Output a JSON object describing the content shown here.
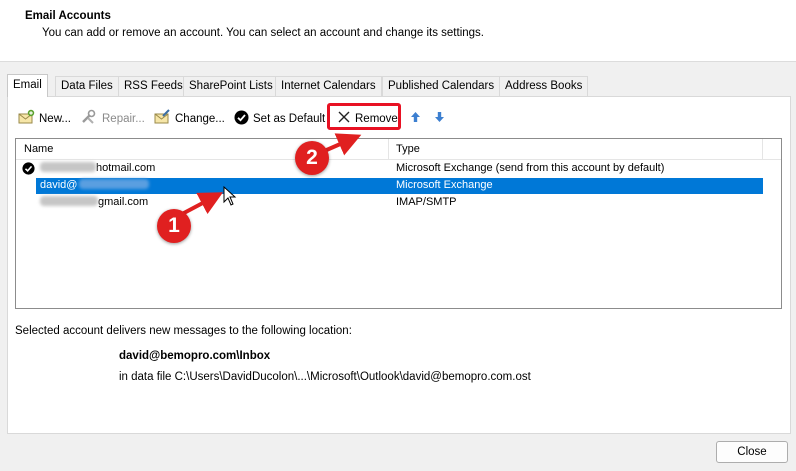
{
  "header": {
    "title": "Email Accounts",
    "subtitle": "You can add or remove an account. You can select an account and change its settings."
  },
  "tabs": [
    {
      "label": "Email",
      "active": true
    },
    {
      "label": "Data Files"
    },
    {
      "label": "RSS Feeds"
    },
    {
      "label": "SharePoint Lists"
    },
    {
      "label": "Internet Calendars"
    },
    {
      "label": "Published Calendars"
    },
    {
      "label": "Address Books"
    }
  ],
  "toolbar": {
    "new_label": "New...",
    "repair_label": "Repair...",
    "change_label": "Change...",
    "set_default_label": "Set as Default",
    "remove_label": "Remove"
  },
  "list": {
    "col_name": "Name",
    "col_type": "Type",
    "rows": [
      {
        "name": "hotmail.com",
        "type": "Microsoft Exchange (send from this account by default)",
        "default": true
      },
      {
        "name": "david@",
        "type": "Microsoft Exchange",
        "selected": true
      },
      {
        "name": "gmail.com",
        "type": "IMAP/SMTP"
      }
    ]
  },
  "delivery": {
    "label": "Selected account delivers new messages to the following location:",
    "folder": "david@bemopro.com\\Inbox",
    "file": "in data file C:\\Users\\DavidDucolon\\...\\Microsoft\\Outlook\\david@bemopro.com.ost"
  },
  "close_label": "Close",
  "annotations": {
    "badge1": "1",
    "badge2": "2",
    "color": "#e02020"
  },
  "colors": {
    "selection": "#0078d7",
    "highlight": "#e81123"
  }
}
